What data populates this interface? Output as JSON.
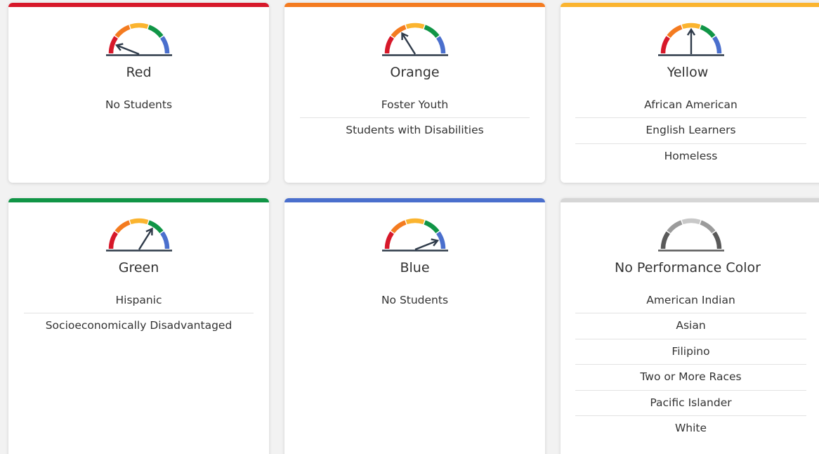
{
  "palette": {
    "red": "#d7182a",
    "orange": "#f47b20",
    "yellow": "#fbb42f",
    "green": "#109546",
    "blue": "#4a6fcd",
    "gray": "#d6d6d6",
    "needle": "#2f3b4a",
    "base": "#555555"
  },
  "cards": [
    {
      "title": "Red",
      "color": "#d7182a",
      "gauge_icon": "gauge-needle-red-icon",
      "gauge_level": "red",
      "groups": [
        "No Students"
      ]
    },
    {
      "title": "Orange",
      "color": "#f47b20",
      "gauge_icon": "gauge-needle-orange-icon",
      "gauge_level": "orange",
      "groups": [
        "Foster Youth",
        "Students with Disabilities"
      ]
    },
    {
      "title": "Yellow",
      "color": "#fbb42f",
      "gauge_icon": "gauge-needle-yellow-icon",
      "gauge_level": "yellow",
      "groups": [
        "African American",
        "English Learners",
        "Homeless"
      ]
    },
    {
      "title": "Green",
      "color": "#109546",
      "gauge_icon": "gauge-needle-green-icon",
      "gauge_level": "green",
      "groups": [
        "Hispanic",
        "Socioeconomically Disadvantaged"
      ]
    },
    {
      "title": "Blue",
      "color": "#4a6fcd",
      "gauge_icon": "gauge-needle-blue-icon",
      "gauge_level": "blue",
      "groups": [
        "No Students"
      ]
    },
    {
      "title": "No Performance Color",
      "color": "#d6d6d6",
      "gauge_icon": "gauge-gray-icon",
      "gauge_level": "none",
      "groups": [
        "American Indian",
        "Asian",
        "Filipino",
        "Two or More Races",
        "Pacific Islander",
        "White"
      ]
    }
  ]
}
